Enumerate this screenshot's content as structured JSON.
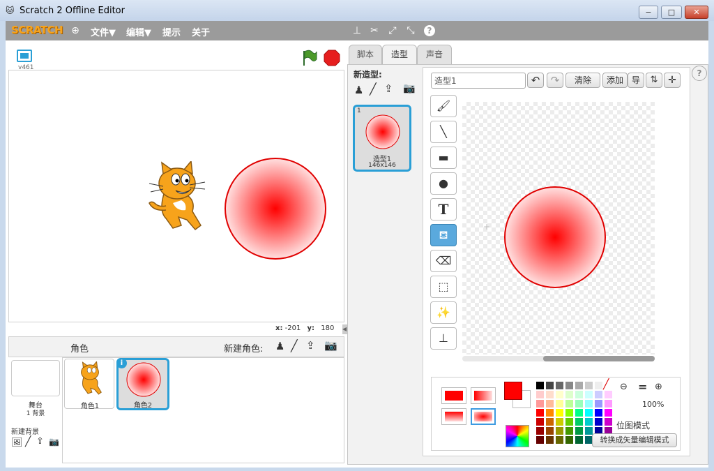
{
  "window": {
    "title": "Scratch 2 Offline Editor",
    "min": "−",
    "max": "□",
    "close": "✕"
  },
  "menu": {
    "logo": "SCRATCH",
    "file": "文件▼",
    "edit": "编辑▼",
    "tips": "提示",
    "about": "关于"
  },
  "stage": {
    "version": "v461",
    "x_label": "x:",
    "x_value": "-201",
    "y_label": "y:",
    "y_value": "180"
  },
  "sprites": {
    "header": "角色",
    "new_sprite_label": "新建角色:",
    "stage_name": "舞台",
    "stage_backdrops": "1 背景",
    "new_backdrop": "新建背景",
    "items": [
      {
        "name": "角色1"
      },
      {
        "name": "角色2"
      }
    ],
    "info_badge": "i"
  },
  "tabs": [
    {
      "label": "脚本"
    },
    {
      "label": "造型"
    },
    {
      "label": "声音"
    }
  ],
  "costumes": {
    "new_label": "新造型:",
    "items": [
      {
        "index": "1",
        "name": "造型1",
        "size": "146x146"
      }
    ]
  },
  "editor": {
    "name_value": "造型1",
    "clear": "清除",
    "add": "添加",
    "import_partial": "导",
    "zoom": "100%",
    "mode_bitmap": "位图模式",
    "convert_vector": "转换成矢量编辑模式"
  },
  "colors": {
    "primary": "#ff0000",
    "selected_fill": "#5aa9dd",
    "accent_blue": "#2a9fd6",
    "menubar": "#9b9b9b"
  },
  "help": "?"
}
